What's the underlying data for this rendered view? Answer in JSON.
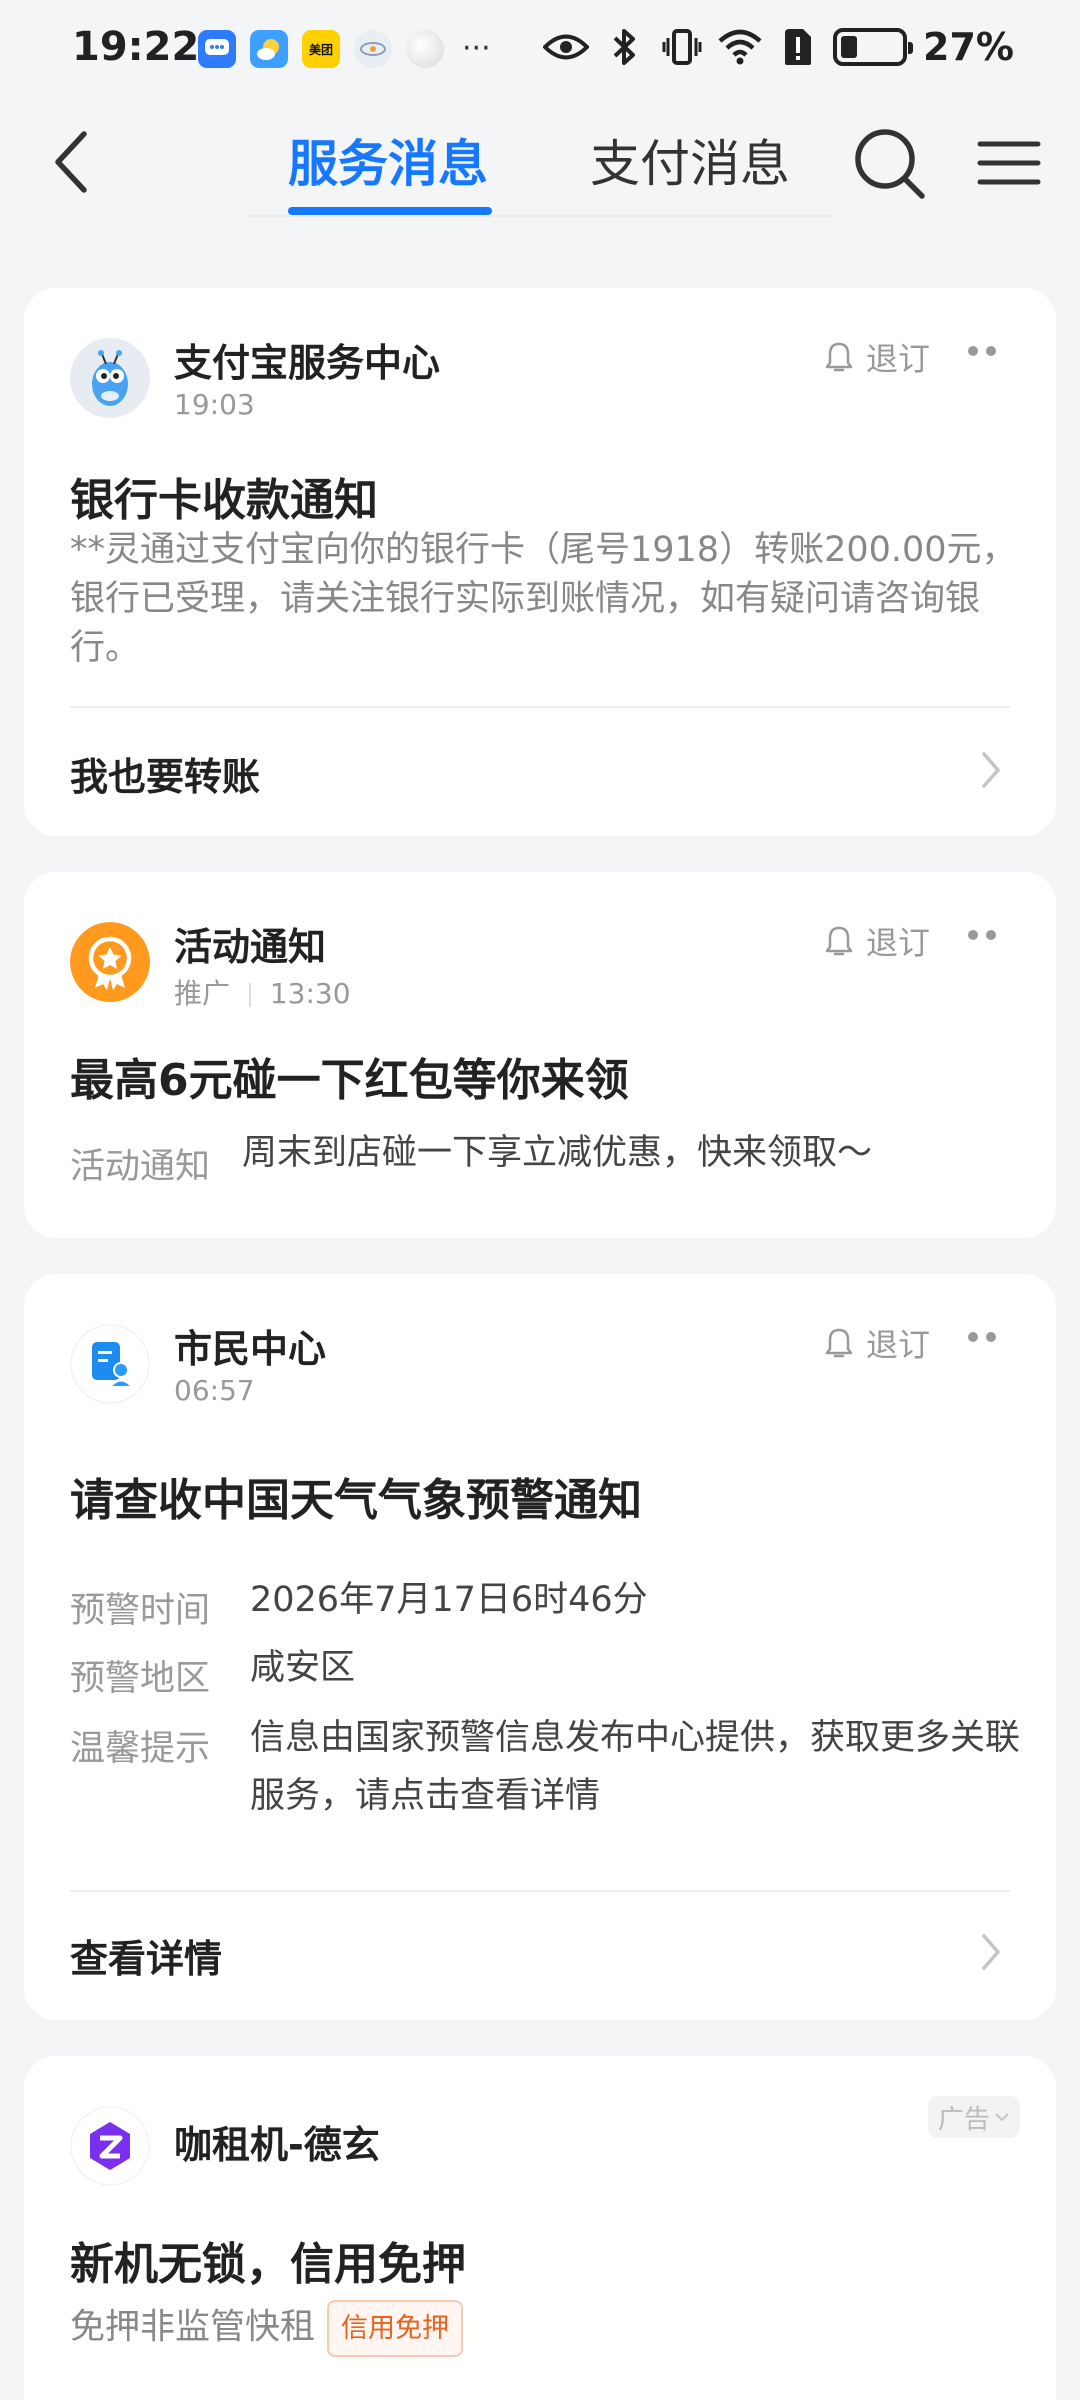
{
  "status_bar": {
    "time": "19:22",
    "battery_pct": "27%",
    "battery_level": 0.27,
    "app_icons": [
      "message-app-icon",
      "weather-app-icon",
      "meituan-app-icon",
      "lotus-app-icon",
      "moon-app-icon"
    ],
    "meituan_label": "美团",
    "overflow": "···"
  },
  "nav": {
    "tabs": [
      {
        "label": "服务消息",
        "active": true
      },
      {
        "label": "支付消息",
        "active": false
      }
    ],
    "accent_color": "#1677ff"
  },
  "cards": [
    {
      "source": "支付宝服务中心",
      "time": "19:03",
      "unsubscribe": "退订",
      "title": "银行卡收款通知",
      "body": "**灵通过支付宝向你的银行卡（尾号1918）转账200.00元，银行已受理，请关注银行实际到账情况，如有疑问请咨询银行。",
      "action": "我也要转账"
    },
    {
      "source": "活动通知",
      "promo": "推广",
      "time": "13:30",
      "unsubscribe": "退订",
      "title": "最高6元碰一下红包等你来领",
      "sub_label": "活动通知",
      "sub_text": "周末到店碰一下享立减优惠，快来领取～"
    },
    {
      "source": "市民中心",
      "time": "06:57",
      "unsubscribe": "退订",
      "title": "请查收中国天气气象预警通知",
      "fields": [
        {
          "label": "预警时间",
          "value": "2026年7月17日6时46分"
        },
        {
          "label": "预警地区",
          "value": "咸安区"
        },
        {
          "label": "温馨提示",
          "value": "信息由国家预警信息发布中心提供，获取更多关联服务，请点击查看详情"
        }
      ],
      "action": "查看详情"
    },
    {
      "source": "咖租机-德玄",
      "ad_label": "广告",
      "title": "新机无锁，信用免押",
      "sub_text": "免押非监管快租",
      "tag": "信用免押"
    }
  ]
}
